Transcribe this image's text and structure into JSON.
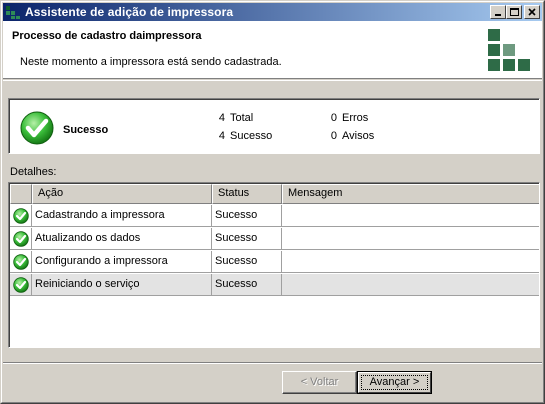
{
  "window": {
    "title": "Assistente de adição de impressora"
  },
  "header": {
    "title": "Processo de cadastro daimpressora",
    "subtitle": "Neste momento a impressora está sendo cadastrada."
  },
  "summary": {
    "status_label": "Sucesso",
    "total_count": "4",
    "total_label": "Total",
    "success_count": "4",
    "success_label": "Sucesso",
    "errors_count": "0",
    "errors_label": "Erros",
    "warnings_count": "0",
    "warnings_label": "Avisos"
  },
  "details": {
    "label": "Detalhes:",
    "columns": [
      "",
      "Ação",
      "Status",
      "Mensagem"
    ],
    "rows": [
      {
        "acao": "Cadastrando a impressora",
        "status": "Sucesso",
        "mensagem": ""
      },
      {
        "acao": "Atualizando os dados",
        "status": "Sucesso",
        "mensagem": ""
      },
      {
        "acao": "Configurando a impressora",
        "status": "Sucesso",
        "mensagem": ""
      },
      {
        "acao": "Reiniciando o serviço",
        "status": "Sucesso",
        "mensagem": ""
      }
    ],
    "selected_row": 3
  },
  "buttons": {
    "back": "< Voltar",
    "next": "Avançar >"
  },
  "colors": {
    "titlebar_start": "#0a246a",
    "titlebar_end": "#a6caf0",
    "logo": "#2e6b47",
    "success": "#3cbf3c"
  }
}
